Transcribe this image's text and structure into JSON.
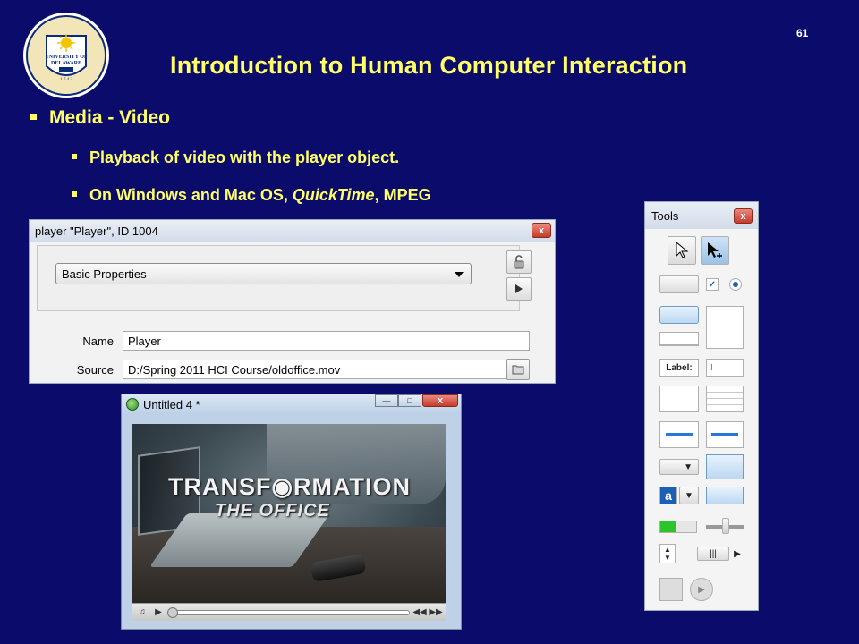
{
  "slide": {
    "number": "61",
    "title": "Introduction to Human Computer Interaction",
    "logo_text": "UNIVERSITY OF DELAWARE 1743"
  },
  "bullets": {
    "b1": "Media - Video",
    "b2": "Playback of video with the player object.",
    "b3_pre": "On Windows and Mac OS, ",
    "b3_italic": "QuickTime",
    "b3_post": ", MPEG"
  },
  "props_window": {
    "title": "player \"Player\", ID 1004",
    "close_label": "x",
    "selected_tab": "Basic Properties",
    "name_label": "Name",
    "name_value": "Player",
    "source_label": "Source",
    "source_value": "D:/Spring 2011 HCI Course/oldoffice.mov"
  },
  "player_window": {
    "title": "Untitled 4 *",
    "close_label": "x",
    "video_line1": "TRANSF◉RMATION",
    "video_line2": "THE OFFICE"
  },
  "tools_palette": {
    "title": "Tools",
    "close_label": "x",
    "label_tool": "Label:"
  },
  "colors": {
    "background": "#0b0b6b",
    "title_yellow": "#ffff66"
  }
}
